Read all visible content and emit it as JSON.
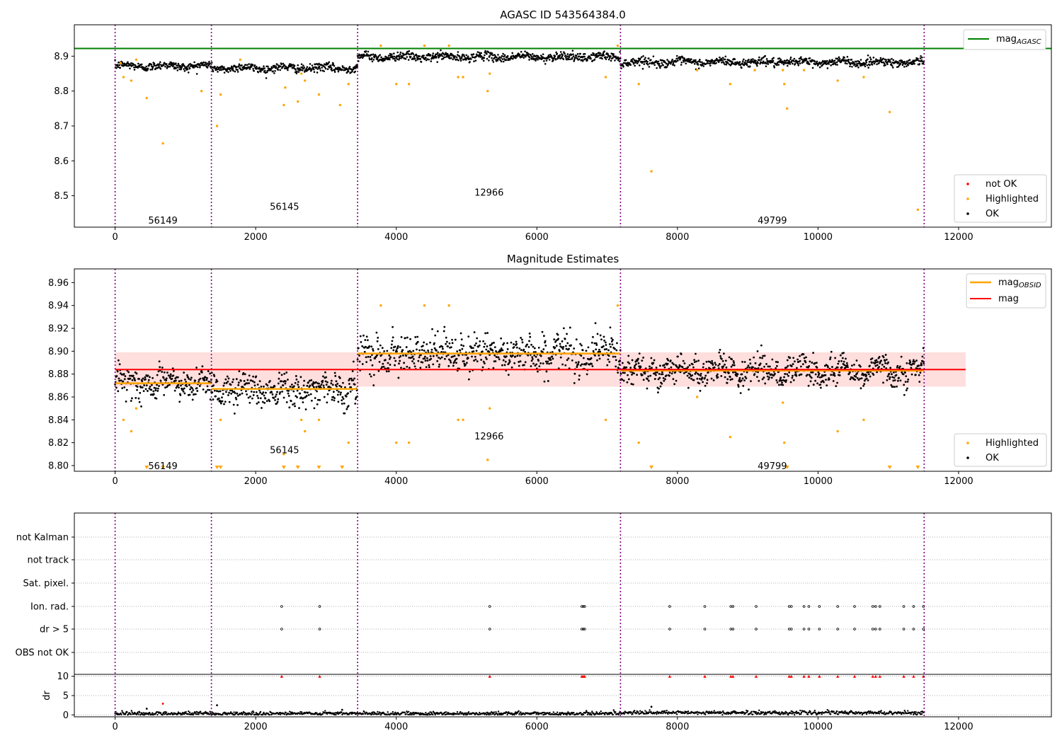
{
  "chart_data": [
    {
      "type": "scatter",
      "title": "AGASC ID 543564384.0",
      "xlim": [
        -580,
        13320
      ],
      "ylim": [
        8.41,
        8.99
      ],
      "xticks": [
        0,
        2000,
        4000,
        6000,
        8000,
        10000,
        12000
      ],
      "yticks": [
        8.5,
        8.6,
        8.7,
        8.8,
        8.9
      ],
      "x_start": 0,
      "x_end": 11520,
      "obsid_boundaries": [
        0,
        1370,
        3450,
        7190,
        11510
      ],
      "reference_lines": [
        {
          "name": "mag_AGASC",
          "value": 8.922,
          "color": "#008000"
        }
      ],
      "segments": [
        {
          "label": "56149",
          "x_start": 0,
          "x_end": 1370,
          "mean": 8.872,
          "label_x": 680,
          "label_y": 8.43
        },
        {
          "label": "56145",
          "x_start": 1370,
          "x_end": 3450,
          "mean": 8.866,
          "label_x": 2410,
          "label_y": 8.47
        },
        {
          "label": "12966",
          "x_start": 3450,
          "x_end": 7190,
          "mean": 8.898,
          "label_x": 5320,
          "label_y": 8.51
        },
        {
          "label": "49799",
          "x_start": 7190,
          "x_end": 11510,
          "mean": 8.883,
          "label_x": 9350,
          "label_y": 8.43
        }
      ],
      "series": [
        {
          "name": "not OK",
          "color": "#ff0000",
          "points": []
        },
        {
          "name": "Highlighted",
          "color": "#ffa500",
          "points": [
            [
              80,
              8.88
            ],
            [
              120,
              8.84
            ],
            [
              230,
              8.83
            ],
            [
              300,
              8.89
            ],
            [
              450,
              8.78
            ],
            [
              680,
              8.65
            ],
            [
              1230,
              8.8
            ],
            [
              1450,
              8.7
            ],
            [
              1500,
              8.79
            ],
            [
              1780,
              8.89
            ],
            [
              2400,
              8.76
            ],
            [
              2420,
              8.81
            ],
            [
              2600,
              8.77
            ],
            [
              2650,
              8.85
            ],
            [
              2700,
              8.83
            ],
            [
              2900,
              8.79
            ],
            [
              3200,
              8.76
            ],
            [
              3320,
              8.82
            ],
            [
              3780,
              8.93
            ],
            [
              4000,
              8.82
            ],
            [
              4180,
              8.82
            ],
            [
              4400,
              8.93
            ],
            [
              4750,
              8.93
            ],
            [
              4880,
              8.84
            ],
            [
              4950,
              8.84
            ],
            [
              5300,
              8.8
            ],
            [
              5330,
              8.85
            ],
            [
              6980,
              8.84
            ],
            [
              7150,
              8.93
            ],
            [
              7450,
              8.82
            ],
            [
              7630,
              8.57
            ],
            [
              8280,
              8.86
            ],
            [
              8750,
              8.82
            ],
            [
              9100,
              8.86
            ],
            [
              9500,
              8.86
            ],
            [
              9520,
              8.82
            ],
            [
              9560,
              8.75
            ],
            [
              9800,
              8.86
            ],
            [
              10280,
              8.83
            ],
            [
              10650,
              8.84
            ],
            [
              11020,
              8.74
            ],
            [
              11420,
              8.46
            ]
          ]
        },
        {
          "name": "OK",
          "color": "#000000",
          "points": []
        }
      ],
      "legend": [
        {
          "name": "mag_AGASC",
          "location": "top-right"
        },
        {
          "names": [
            "not OK",
            "Highlighted",
            "OK"
          ],
          "location": "bottom-right"
        }
      ]
    },
    {
      "type": "scatter",
      "title": "Magnitude Estimates",
      "xlim": [
        -580,
        13320
      ],
      "ylim": [
        8.795,
        8.972
      ],
      "xticks": [
        0,
        2000,
        4000,
        6000,
        8000,
        10000,
        12000
      ],
      "yticks": [
        8.8,
        8.82,
        8.84,
        8.86,
        8.88,
        8.9,
        8.92,
        8.94,
        8.96
      ],
      "x_start": 0,
      "x_end": 11520,
      "obsid_boundaries": [
        0,
        1370,
        3450,
        7190,
        11510
      ],
      "mag_line": {
        "name": "mag",
        "value": 8.884,
        "band": [
          8.869,
          8.899
        ],
        "x_range": [
          0,
          12100
        ],
        "color": "#ff0000"
      },
      "segments": [
        {
          "label": "56149",
          "x_start": 0,
          "x_end": 1370,
          "mean": 8.872,
          "spread": 0.0065,
          "label_x": 680,
          "label_y": 8.8
        },
        {
          "label": "56145",
          "x_start": 1370,
          "x_end": 3450,
          "mean": 8.867,
          "spread": 0.007,
          "label_x": 2410,
          "label_y": 8.814
        },
        {
          "label": "12966",
          "x_start": 3450,
          "x_end": 7190,
          "mean": 8.898,
          "spread": 0.008,
          "label_x": 5320,
          "label_y": 8.826
        },
        {
          "label": "49799",
          "x_start": 7190,
          "x_end": 11510,
          "mean": 8.883,
          "spread": 0.006,
          "label_x": 9350,
          "label_y": 8.8
        }
      ],
      "series": [
        {
          "name": "Highlighted",
          "color": "#ffa500",
          "points": [
            [
              120,
              8.84
            ],
            [
              230,
              8.83
            ],
            [
              300,
              8.85
            ],
            [
              1500,
              8.84
            ],
            [
              2400,
              8.81
            ],
            [
              2650,
              8.84
            ],
            [
              2700,
              8.83
            ],
            [
              2900,
              8.84
            ],
            [
              3320,
              8.82
            ],
            [
              3780,
              8.94
            ],
            [
              4000,
              8.82
            ],
            [
              4180,
              8.82
            ],
            [
              4400,
              8.94
            ],
            [
              4750,
              8.94
            ],
            [
              4880,
              8.84
            ],
            [
              4950,
              8.84
            ],
            [
              5330,
              8.85
            ],
            [
              5300,
              8.805
            ],
            [
              6980,
              8.84
            ],
            [
              7150,
              8.94
            ],
            [
              7450,
              8.82
            ],
            [
              8280,
              8.86
            ],
            [
              8750,
              8.825
            ],
            [
              9500,
              8.855
            ],
            [
              9520,
              8.82
            ],
            [
              10280,
              8.83
            ],
            [
              10650,
              8.84
            ]
          ]
        },
        {
          "name": "OK",
          "color": "#000000",
          "points": []
        }
      ],
      "off_scale_markers": [
        450,
        680,
        1450,
        1500,
        2400,
        2600,
        2900,
        3230,
        7630,
        9560,
        11020,
        11420
      ],
      "legend": [
        {
          "names": [
            "mag_OBSID",
            "mag"
          ],
          "location": "top-right"
        },
        {
          "names": [
            "Highlighted",
            "OK"
          ],
          "location": "bottom-right"
        }
      ]
    },
    {
      "type": "scatter",
      "title": "",
      "xlim": [
        -580,
        13320
      ],
      "xticks": [
        0,
        2000,
        4000,
        6000,
        8000,
        10000,
        12000
      ],
      "obsid_boundaries": [
        0,
        1370,
        3450,
        7190,
        11510
      ],
      "flag_rows": [
        "not Kalman",
        "not track",
        "Sat. pixel.",
        "Ion. rad.",
        "dr > 5",
        "OBS not OK"
      ],
      "flag_events": {
        "Ion. rad.": [
          2370,
          2910,
          5330,
          6640,
          6660,
          6680,
          7890,
          8390,
          8760,
          8790,
          9120,
          9590,
          9620,
          9800,
          9870,
          10020,
          10280,
          10520,
          10780,
          10820,
          10880,
          11220,
          11360,
          11500
        ],
        "dr > 5": [
          2370,
          2910,
          5330,
          6640,
          6660,
          6680,
          7890,
          8390,
          8760,
          8790,
          9120,
          9590,
          9620,
          9800,
          9870,
          10020,
          10280,
          10520,
          10780,
          10820,
          10880,
          11220,
          11360,
          11500
        ]
      },
      "dr": {
        "ylabel": "dr",
        "yticks": [
          0,
          5,
          10
        ],
        "ylim": [
          -0.5,
          10.5
        ],
        "clipped_value": 10,
        "clipped_x": [
          2370,
          2910,
          5330,
          6640,
          6660,
          6680,
          7890,
          8390,
          8760,
          8790,
          9120,
          9590,
          9620,
          9800,
          9870,
          10020,
          10280,
          10520,
          10780,
          10820,
          10880,
          11220,
          11360,
          11500
        ],
        "outliers": [
          [
            680,
            2.9
          ],
          [
            450,
            1.6
          ],
          [
            1450,
            2.5
          ],
          [
            7630,
            2.1
          ],
          [
            3230,
            1.3
          ]
        ]
      }
    }
  ],
  "labels": {
    "x_start_tick": "0",
    "legend_mag_agasc": "mag",
    "legend_mag_agasc_sub": "AGASC",
    "legend_mag_obsid": "mag",
    "legend_mag_obsid_sub": "OBSID",
    "legend_mag": "mag"
  },
  "colors": {
    "green": "#008000",
    "orange": "#ffa500",
    "red": "#ff0000",
    "black": "#000000",
    "purple": "#800080",
    "band": "#ffb6b6",
    "grid": "#b0b0b0"
  }
}
